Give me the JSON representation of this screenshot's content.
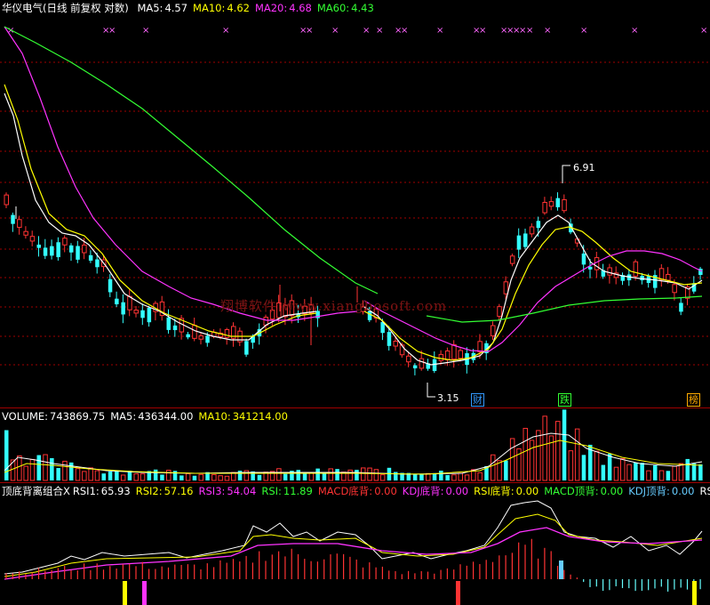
{
  "price_panel": {
    "title": "华仪电气(日线 前复权 对数)",
    "ma": [
      {
        "label": "MA5:",
        "value": "4.57",
        "color": "#ffffff"
      },
      {
        "label": "MA10:",
        "value": "4.62",
        "color": "#ffff00"
      },
      {
        "label": "MA20:",
        "value": "4.68",
        "color": "#ff33ff"
      },
      {
        "label": "MA60:",
        "value": "4.43",
        "color": "#33ff33"
      }
    ],
    "marker_glyph": "×",
    "high_label": "6.91",
    "low_label": "3.15",
    "events": [
      {
        "label": "财",
        "color": "#3399ff"
      },
      {
        "label": "跌",
        "color": "#33ff33"
      },
      {
        "label": "榜",
        "color": "#ffaa00"
      }
    ],
    "watermark": "翔博软件 www.xiangbosoft.com"
  },
  "volume_panel": {
    "items": [
      {
        "label": "VOLUME:",
        "value": "743869.75",
        "color": "#ffffff"
      },
      {
        "label": "MA5:",
        "value": "436344.00",
        "color": "#ffffff"
      },
      {
        "label": "MA10:",
        "value": "341214.00",
        "color": "#ffff00"
      }
    ]
  },
  "indicator_panel": {
    "title": "顶底背离组合X",
    "items": [
      {
        "label": "RSI1:",
        "value": "65.93",
        "color": "#ffffff"
      },
      {
        "label": "RSI2:",
        "value": "57.16",
        "color": "#ffff00"
      },
      {
        "label": "RSI3:",
        "value": "54.04",
        "color": "#ff33ff"
      },
      {
        "label": "RSI:",
        "value": "11.89",
        "color": "#33ff33"
      },
      {
        "label": "MACD底背:",
        "value": "0.00",
        "color": "#ff3333"
      },
      {
        "label": "KDJ底背:",
        "value": "0.00",
        "color": "#ff33ff"
      },
      {
        "label": "RSI底背:",
        "value": "0.00",
        "color": "#ffff00"
      },
      {
        "label": "MACD顶背:",
        "value": "0.00",
        "color": "#33ff33"
      },
      {
        "label": "KDJ顶背:",
        "value": "0.00",
        "color": "#66ccff"
      },
      {
        "label": "RS",
        "value": "",
        "color": "#ffffff"
      }
    ]
  },
  "colors": {
    "background": "#000000",
    "up": "#ff3333",
    "down": "#33ffff",
    "grid": "#a00000"
  }
}
